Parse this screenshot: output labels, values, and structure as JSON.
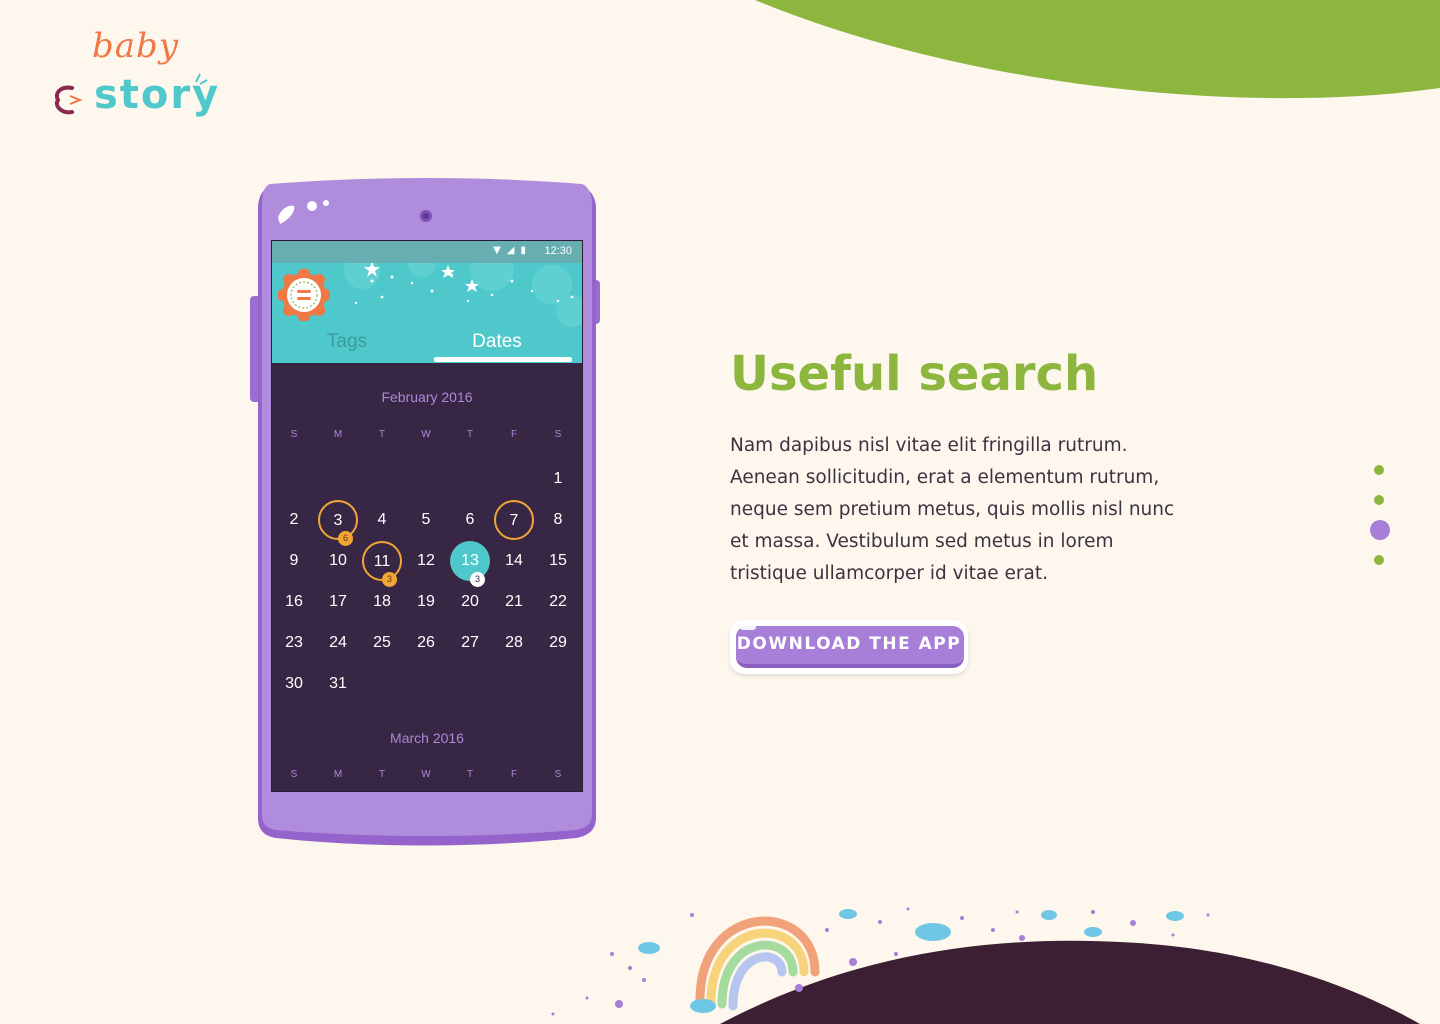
{
  "brand": {
    "logo_top": "baby",
    "logo_bottom": "story",
    "colors": {
      "green": "#8db63f",
      "purple": "#a77fd8",
      "teal": "#4ec8cb",
      "dark": "#382744",
      "orange": "#f07845"
    }
  },
  "phone": {
    "status_time": "12:30",
    "status_icons": [
      "wifi-icon",
      "signal-icon",
      "battery-icon"
    ],
    "menu_icon": "equals-badge-icon",
    "tabs": [
      {
        "label": "Tags",
        "active": false
      },
      {
        "label": "Dates",
        "active": true
      }
    ],
    "calendar": {
      "weekdays": [
        "S",
        "M",
        "T",
        "W",
        "T",
        "F",
        "S"
      ],
      "months": [
        {
          "title": "February 2016",
          "weeks": [
            [
              "",
              "",
              "",
              "",
              "",
              "",
              "1"
            ],
            [
              "2",
              "3",
              "4",
              "5",
              "6",
              "7",
              "8"
            ],
            [
              "9",
              "10",
              "11",
              "12",
              "13",
              "14",
              "15"
            ],
            [
              "16",
              "17",
              "18",
              "19",
              "20",
              "21",
              "22"
            ],
            [
              "23",
              "24",
              "25",
              "26",
              "27",
              "28",
              "29"
            ],
            [
              "30",
              "31",
              "",
              "",
              "",
              "",
              ""
            ]
          ],
          "marked_days": [
            {
              "day": "3",
              "count": "6",
              "style": "ring"
            },
            {
              "day": "7",
              "count": "",
              "style": "ring"
            },
            {
              "day": "11",
              "count": "3",
              "style": "ring"
            },
            {
              "day": "13",
              "count": "3",
              "style": "selected"
            }
          ]
        },
        {
          "title": "March 2016"
        }
      ]
    }
  },
  "content": {
    "heading": "Useful search",
    "body": "Nam dapibus nisl vitae elit fringilla rutrum. Aenean sollicitudin, erat a elementum rutrum, neque sem pretium metus, quis mollis nisl nunc et massa. Vestibulum sed metus in lorem tristique ullamcorper id vitae erat.",
    "cta_label": "DOWNLOAD THE APP"
  },
  "pager": {
    "count": 4,
    "active_index": 2
  }
}
